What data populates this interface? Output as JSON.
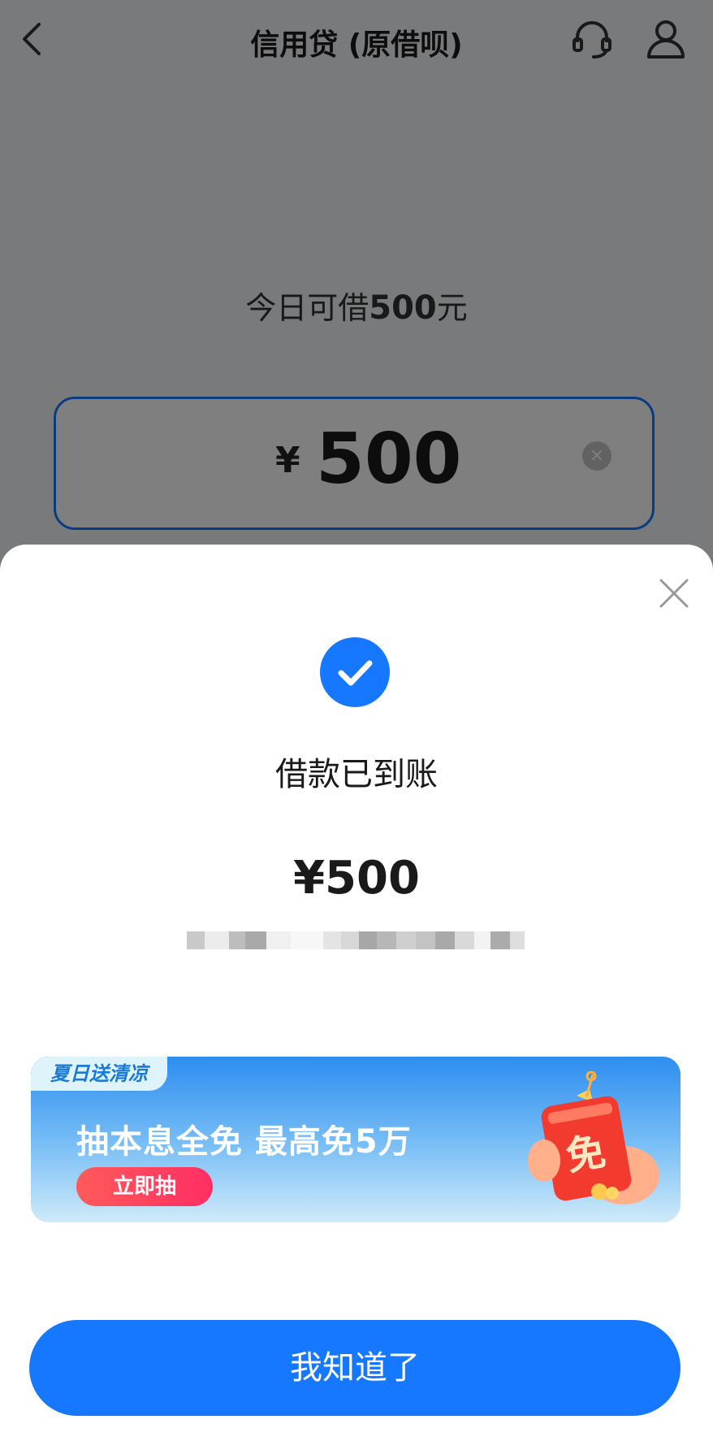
{
  "header": {
    "title": "信用贷 (原借呗)"
  },
  "borrow": {
    "limit_prefix": "今日可借",
    "limit_amount": "500",
    "limit_suffix": "元",
    "currency": "¥",
    "input_value": "500"
  },
  "result": {
    "title": "借款已到账",
    "amount": "¥500"
  },
  "promo": {
    "tag": "夏日送清凉",
    "title": "抽本息全免 最高免5万",
    "button": "立即抽",
    "art_text": "免"
  },
  "actions": {
    "confirm": "我知道了"
  },
  "colors": {
    "primary": "#1677ff",
    "promo_button": "#ff3b5c"
  }
}
